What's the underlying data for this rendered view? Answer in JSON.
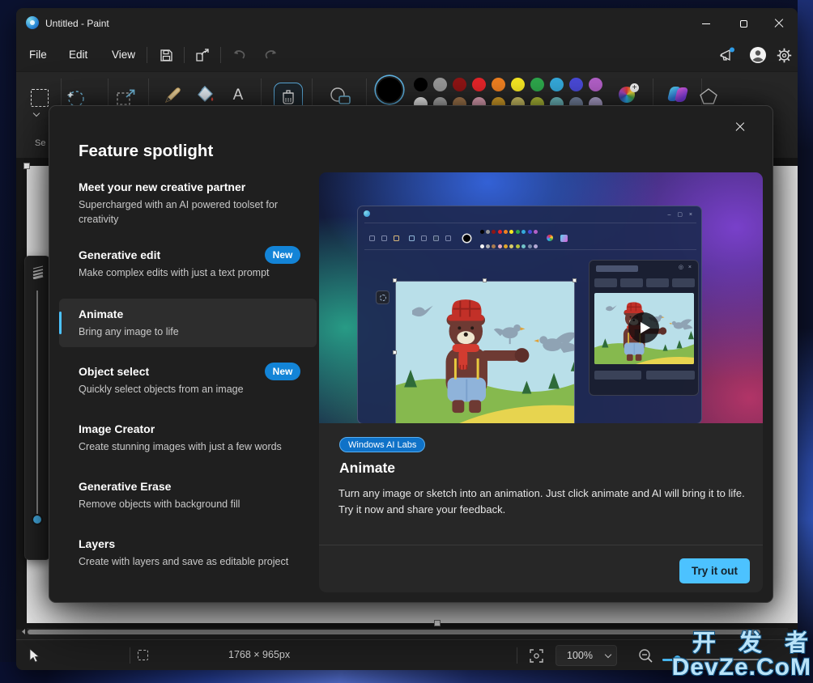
{
  "titlebar": {
    "title": "Untitled - Paint"
  },
  "menubar": {
    "items": [
      "File",
      "Edit",
      "View"
    ]
  },
  "toolbar": {
    "selection_label_partial": "Se",
    "selected_color": "#000000",
    "palette_row1": [
      "#000000",
      "#989898",
      "#8F1515",
      "#E5252A",
      "#F08021",
      "#F7E823",
      "#2EA84C",
      "#35AADC",
      "#4A4AD8",
      "#B360C8"
    ],
    "palette_row2": [
      "#F5F5F5",
      "#B0B0B0",
      "#A87B50",
      "#E9A8BC",
      "#DFA62B",
      "#D8CC6A",
      "#B5C23A",
      "#72C3C8",
      "#7B8AA8",
      "#B4A8D4"
    ]
  },
  "dialog": {
    "title": "Feature spotlight",
    "features": [
      {
        "title": "Meet your new creative partner",
        "desc": "Supercharged with an AI powered toolset for creativity"
      },
      {
        "title": "Generative edit",
        "desc": "Make complex edits with just a text prompt",
        "badge": "New"
      },
      {
        "title": "Animate",
        "desc": "Bring any image to life",
        "selected": true
      },
      {
        "title": "Object select",
        "desc": "Quickly select objects from an image",
        "badge": "New"
      },
      {
        "title": "Image Creator",
        "desc": "Create stunning images with just a few words"
      },
      {
        "title": "Generative Erase",
        "desc": "Remove objects with background fill"
      },
      {
        "title": "Layers",
        "desc": "Create with layers and save as editable project"
      }
    ],
    "detail": {
      "badge": "Windows AI Labs",
      "title": "Animate",
      "description": "Turn any image or sketch into an animation. Just click animate and AI will bring it to life. Try it now and share your feedback.",
      "cta": "Try it out"
    }
  },
  "statusbar": {
    "canvas_size": "1768 × 965px",
    "zoom_level": "100%"
  },
  "watermark": {
    "line1": "开 发 者",
    "line2": "DevZe.CoM"
  },
  "colors": {
    "accent": "#4CC2FF",
    "badge_blue": "#1384D7",
    "labs_badge": "#0F72C8"
  }
}
